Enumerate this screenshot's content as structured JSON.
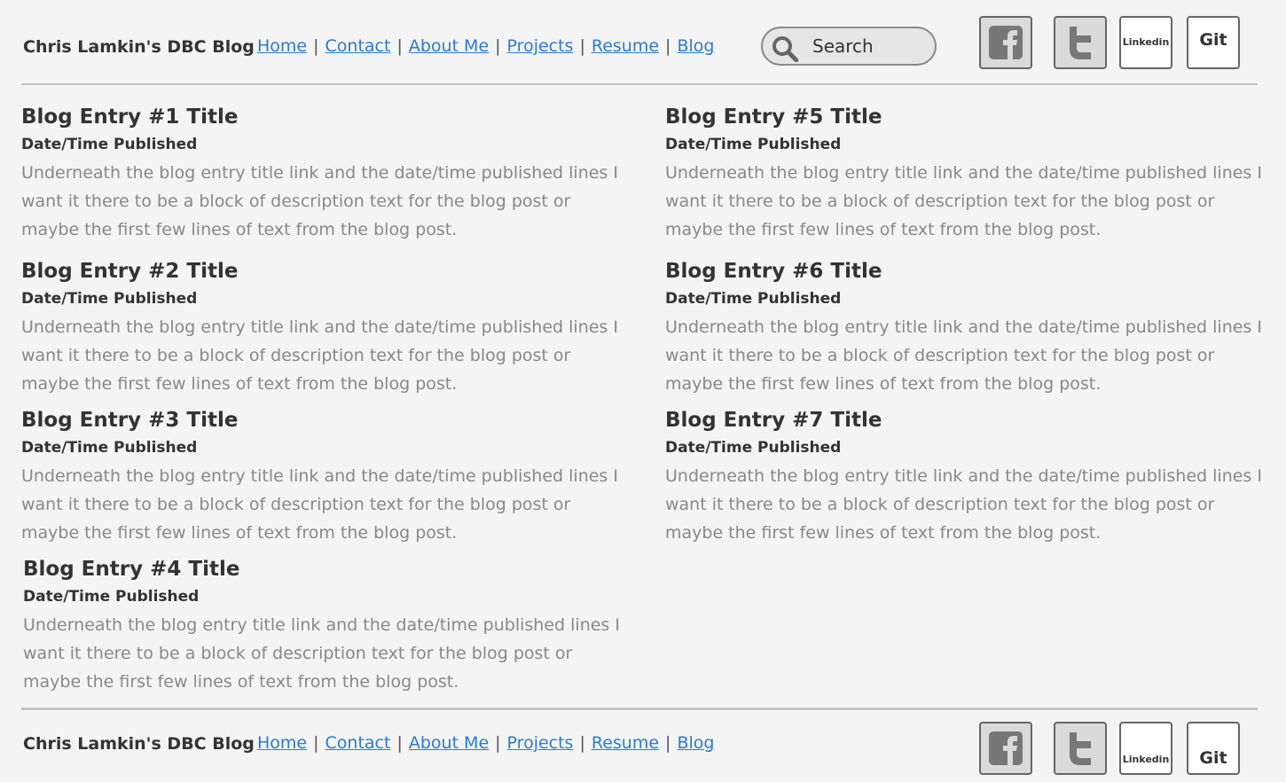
{
  "site": {
    "title": "Chris Lamkin's DBC Blog"
  },
  "nav": {
    "items": [
      {
        "label": "Home"
      },
      {
        "label": "Contact"
      },
      {
        "label": "About Me"
      },
      {
        "label": "Projects"
      },
      {
        "label": "Resume"
      },
      {
        "label": "Blog"
      }
    ],
    "separator": "|"
  },
  "search": {
    "label": "Search"
  },
  "social": {
    "facebook": {
      "icon": "facebook-icon"
    },
    "twitter": {
      "icon": "twitter-icon"
    },
    "linkedin": {
      "label": "Linkedin"
    },
    "git": {
      "label": "Git"
    }
  },
  "entries": [
    {
      "title": "Blog Entry #1 Title",
      "date": "Date/Time Published",
      "description": "Underneath the blog entry title link and the date/time published lines I want it there to be a block of description text for the blog post or maybe the first few lines of text from the blog post."
    },
    {
      "title": "Blog Entry #2 Title",
      "date": "Date/Time Published",
      "description": "Underneath the blog entry title link and the date/time published lines I want it there to be a block of description text for the blog post or maybe the first few lines of text from the blog post."
    },
    {
      "title": "Blog Entry #3 Title",
      "date": "Date/Time Published",
      "description": "Underneath the blog entry title link and the date/time published lines I want it there to be a block of description text for the blog post or maybe the first few lines of text from the blog post."
    },
    {
      "title": "Blog Entry #4 Title",
      "date": "Date/Time Published",
      "description": "Underneath the blog entry title link and the date/time published lines I want it there to be a block of description text for the blog post or maybe the first few lines of text from the blog post."
    },
    {
      "title": "Blog Entry #5 Title",
      "date": "Date/Time Published",
      "description": "Underneath the blog entry title link and the date/time published lines I want it there to be a block of description text for the blog post or maybe the first few lines of text from the blog post."
    },
    {
      "title": "Blog Entry #6 Title",
      "date": "Date/Time Published",
      "description": "Underneath the blog entry title link and the date/time published lines I want it there to be a block of description text for the blog post or maybe the first few lines of text from the blog post."
    },
    {
      "title": "Blog Entry #7 Title",
      "date": "Date/Time Published",
      "description": "Underneath the blog entry title link and the date/time published lines I want it there to be a block of description text for the blog post or maybe the first few lines of text from the blog post."
    }
  ],
  "colors": {
    "link": "#2a7ad2",
    "text": "#333333",
    "muted": "#888888",
    "background": "#f4f4f4"
  }
}
